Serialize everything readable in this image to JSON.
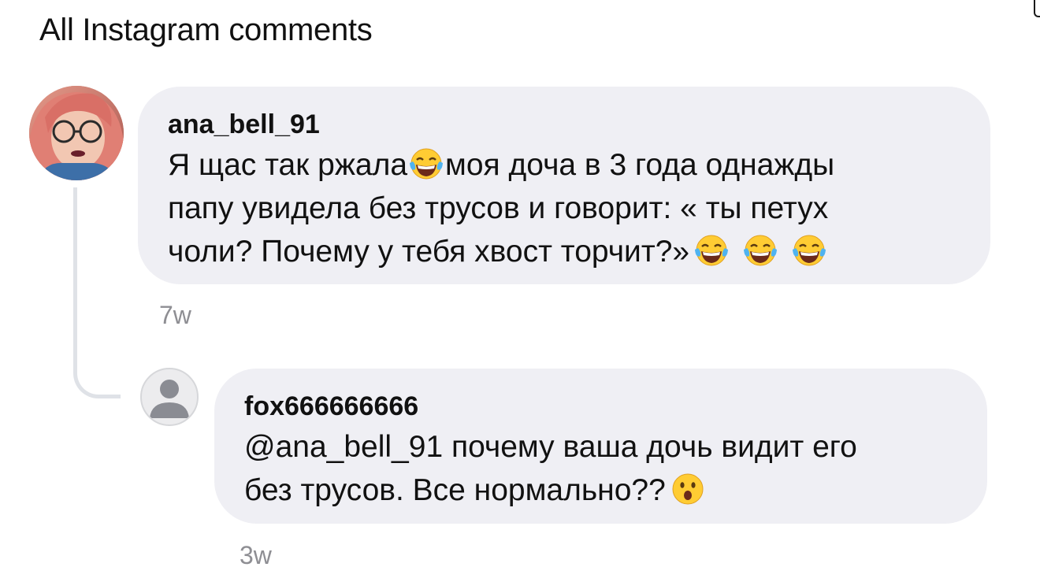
{
  "header": {
    "title": "All Instagram comments"
  },
  "comments": [
    {
      "username": "ana_bell_91",
      "lines": [
        {
          "a": "Я щас так ржала",
          "b": "моя доча в 3 года однажды"
        },
        {
          "a": "папу увидела без трусов и говорит: « ты петух"
        },
        {
          "a": "чоли? Почему у тебя хвост торчит?»"
        }
      ],
      "time": "7w",
      "emojis": [
        "face-with-tears-of-joy-icon"
      ]
    },
    {
      "username": "fox666666666",
      "lines": [
        {
          "a": "@ana_bell_91 почему ваша дочь видит его"
        },
        {
          "a": "без трусов. Все нормально??"
        }
      ],
      "time": "3w",
      "emojis": [
        "face-with-open-mouth-icon"
      ]
    }
  ],
  "colors": {
    "bubble": "#efeff4",
    "timestamp": "#8e8e93",
    "thread_line": "#dfe2e7",
    "text": "#111111"
  }
}
